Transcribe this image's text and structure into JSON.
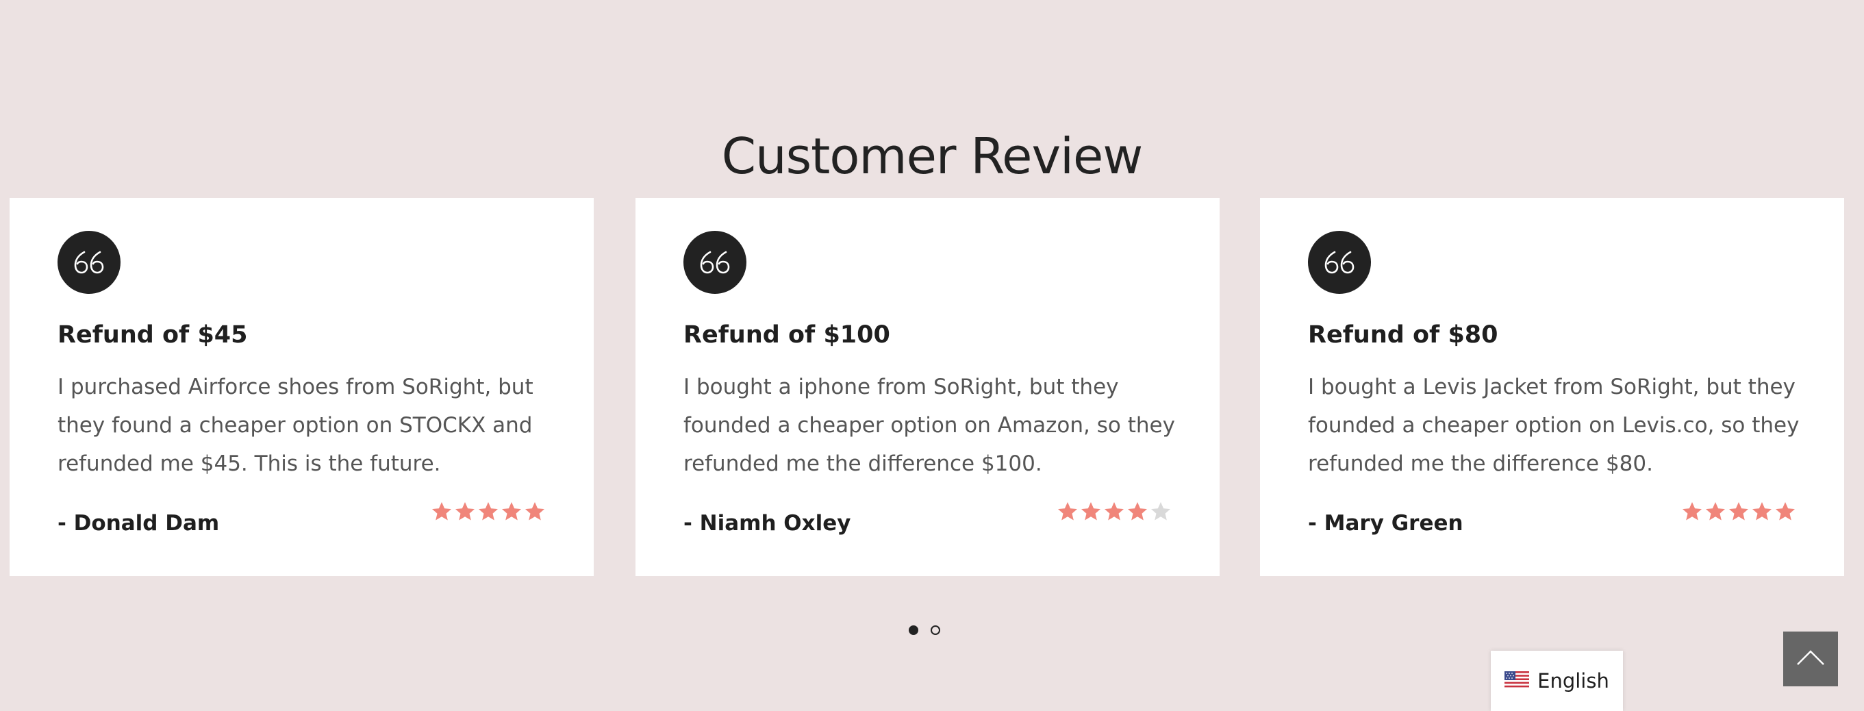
{
  "section": {
    "title": "Customer Review"
  },
  "reviews": [
    {
      "heading": "Refund of $45",
      "body": "I purchased Airforce shoes from SoRight, but they found a cheaper option on STOCKX and refunded me $45. This is the future.",
      "author": "- Donald Dam",
      "rating": 5,
      "max_rating": 5
    },
    {
      "heading": "Refund of $100",
      "body": "I bought a iphone from SoRight, but they founded a cheaper option on Amazon, so they refunded me the difference $100.",
      "author": "- Niamh Oxley",
      "rating": 4,
      "max_rating": 5
    },
    {
      "heading": "Refund of $80",
      "body": "I bought a Levis Jacket from SoRight, but they founded a cheaper option on Levis.co, so they refunded me the difference $80.",
      "author": "- Mary Green",
      "rating": 5,
      "max_rating": 5
    }
  ],
  "carousel": {
    "page_count": 2,
    "active_page": 1
  },
  "language": {
    "label": "English",
    "flag_icon": "us-flag-icon"
  },
  "icons": {
    "quote": "quote-icon",
    "star": "star-icon",
    "back_to_top": "chevron-up-icon"
  },
  "colors": {
    "background": "#ece2e2",
    "card": "#ffffff",
    "badge": "#222222",
    "star_filled": "#f0857a",
    "star_empty": "#d9d9d9",
    "back_to_top": "#666666"
  }
}
